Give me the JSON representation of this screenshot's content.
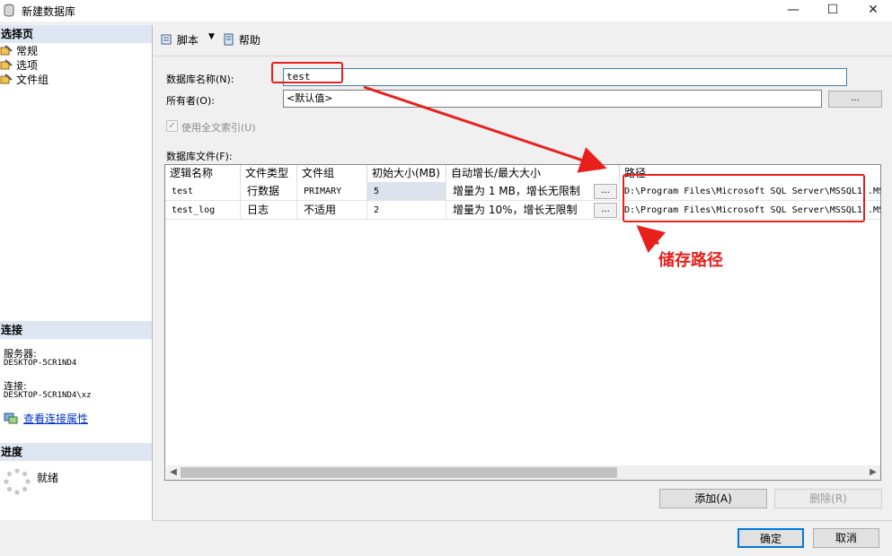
{
  "window": {
    "title": "新建数据库",
    "minimize": "—",
    "maximize": "☐",
    "close": "✕"
  },
  "left": {
    "select_page": "选择页",
    "pages": [
      "常规",
      "选项",
      "文件组"
    ],
    "connection_header": "连接",
    "server_label": "服务器:",
    "server_value": "DESKTOP-5CR1ND4",
    "connection_label": "连接:",
    "connection_value": "DESKTOP-5CR1ND4\\xz",
    "view_props_link": "查看连接属性",
    "progress_header": "进度",
    "progress_status": "就绪"
  },
  "toolbar": {
    "script": "脚本",
    "help": "帮助"
  },
  "form": {
    "db_name_label": "数据库名称(N):",
    "db_name_value": "test",
    "owner_label": "所有者(O):",
    "owner_value": "<默认值>",
    "owner_browse": "...",
    "fulltext_label": "使用全文索引(U)",
    "fulltext_checked": true,
    "files_label": "数据库文件(F):"
  },
  "files_table": {
    "headers": [
      "逻辑名称",
      "文件类型",
      "文件组",
      "初始大小(MB)",
      "自动增长/最大大小",
      "路径"
    ],
    "rows": [
      {
        "name": "test",
        "type": "行数据",
        "filegroup": "PRIMARY",
        "size": "5",
        "growth": "增量为 1 MB，增长无限制",
        "path": "D:\\Program Files\\Microsoft SQL Server\\MSSQL1 .MS"
      },
      {
        "name": "test_log",
        "type": "日志",
        "filegroup": "不适用",
        "size": "2",
        "growth": "增量为 10%，增长无限制",
        "path": "D:\\Program Files\\Microsoft SQL Server\\MSSQL1 .MS"
      }
    ],
    "ellipsis": "..."
  },
  "buttons": {
    "add": "添加(A)",
    "remove": "删除(R)",
    "ok": "确定",
    "cancel": "取消"
  },
  "annotation": {
    "text": "储存路径",
    "color": "#e8201c"
  }
}
